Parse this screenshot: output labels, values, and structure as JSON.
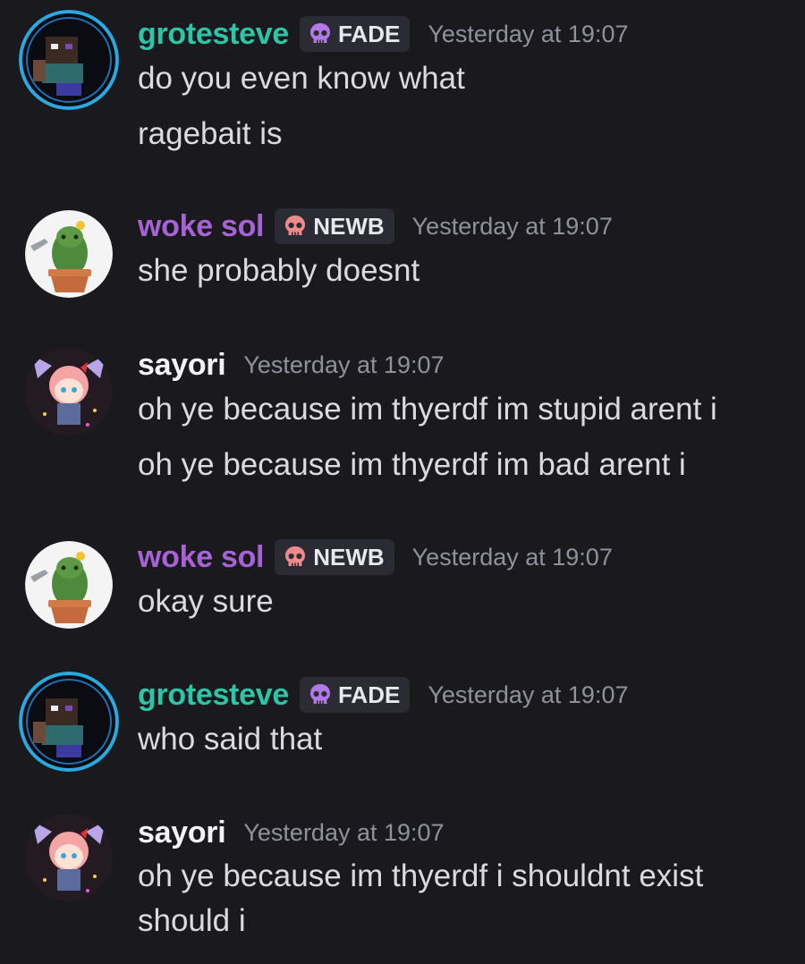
{
  "colors": {
    "background": "#1a1a1e",
    "grotesteve": "#2ec4a6",
    "woke_sol": "#a763d6",
    "sayori": "#f2f3f5",
    "timestamp": "#8f929c",
    "message_text": "#dadbe0",
    "tag_background": "#2b2c33"
  },
  "messages": [
    {
      "username": "grotesteve",
      "tag": {
        "label": "FADE",
        "icon": "purple-skull-icon"
      },
      "time": "Yesterday at 19:07",
      "lines": [
        "do you even know what",
        "ragebait is"
      ]
    },
    {
      "username": "woke sol",
      "tag": {
        "label": "NEWB",
        "icon": "pink-skull-icon"
      },
      "time": "Yesterday at 19:07",
      "lines": [
        "she probably doesnt"
      ]
    },
    {
      "username": "sayori",
      "time": "Yesterday at 19:07",
      "lines": [
        "oh ye because im thyerdf im stupid arent i",
        "oh ye because im thyerdf im bad arent i"
      ]
    },
    {
      "username": "woke sol",
      "tag": {
        "label": "NEWB",
        "icon": "pink-skull-icon"
      },
      "time": "Yesterday at 19:07",
      "lines": [
        "okay sure"
      ]
    },
    {
      "username": "grotesteve",
      "tag": {
        "label": "FADE",
        "icon": "purple-skull-icon"
      },
      "time": "Yesterday at 19:07",
      "lines": [
        "who said that"
      ]
    },
    {
      "username": "sayori",
      "time": "Yesterday at 19:07",
      "lines": [
        "oh ye because im thyerdf i shouldnt exist",
        "should i"
      ]
    }
  ]
}
